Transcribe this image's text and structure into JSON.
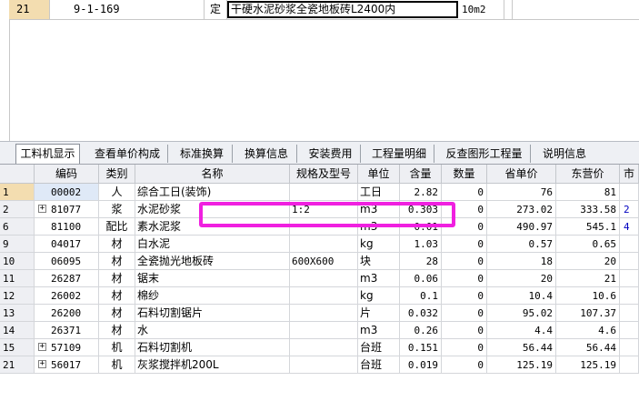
{
  "top_row": {
    "row_num": "21",
    "code": "9-1-169",
    "type": "定",
    "name": "干硬水泥砂浆全瓷地板砖L2400内",
    "unit": "10m2"
  },
  "tabs": [
    {
      "label": "工料机显示",
      "active": true
    },
    {
      "label": "查看单价构成"
    },
    {
      "label": "标准换算"
    },
    {
      "label": "换算信息"
    },
    {
      "label": "安装费用"
    },
    {
      "label": "工程量明细"
    },
    {
      "label": "反查图形工程量"
    },
    {
      "label": "说明信息"
    }
  ],
  "columns": [
    "编码",
    "类别",
    "名称",
    "规格及型号",
    "单位",
    "含量",
    "数量",
    "省单价",
    "东营价",
    "市"
  ],
  "rows": [
    {
      "rn": "1",
      "code": "00002",
      "cat": "人",
      "name": "综合工日(装饰)",
      "spec": "",
      "unit": "工日",
      "qty": "2.82",
      "cnt": "0",
      "prov": "76",
      "dong": "81",
      "mkt": ""
    },
    {
      "rn": "2",
      "code": "81077",
      "cat": "浆",
      "name": "水泥砂浆",
      "spec": "1:2",
      "unit": "m3",
      "qty": "0.303",
      "cnt": "0",
      "prov": "273.02",
      "dong": "333.58",
      "mkt": "2",
      "expandable": true
    },
    {
      "rn": "6",
      "code": "81100",
      "cat": "配比",
      "name": "素水泥浆",
      "spec": "",
      "unit": "m3",
      "qty": "0.01",
      "cnt": "0",
      "prov": "490.97",
      "dong": "545.1",
      "mkt": "4"
    },
    {
      "rn": "9",
      "code": "04017",
      "cat": "材",
      "name": "白水泥",
      "spec": "",
      "unit": "kg",
      "qty": "1.03",
      "cnt": "0",
      "prov": "0.57",
      "dong": "0.65",
      "mkt": ""
    },
    {
      "rn": "10",
      "code": "06095",
      "cat": "材",
      "name": "全瓷抛光地板砖",
      "spec": "600X600",
      "unit": "块",
      "qty": "28",
      "cnt": "0",
      "prov": "18",
      "dong": "20",
      "mkt": ""
    },
    {
      "rn": "11",
      "code": "26287",
      "cat": "材",
      "name": "锯末",
      "spec": "",
      "unit": "m3",
      "qty": "0.06",
      "cnt": "0",
      "prov": "20",
      "dong": "21",
      "mkt": ""
    },
    {
      "rn": "12",
      "code": "26002",
      "cat": "材",
      "name": "棉纱",
      "spec": "",
      "unit": "kg",
      "qty": "0.1",
      "cnt": "0",
      "prov": "10.4",
      "dong": "10.6",
      "mkt": ""
    },
    {
      "rn": "13",
      "code": "26200",
      "cat": "材",
      "name": "石料切割锯片",
      "spec": "",
      "unit": "片",
      "qty": "0.032",
      "cnt": "0",
      "prov": "95.02",
      "dong": "107.37",
      "mkt": ""
    },
    {
      "rn": "14",
      "code": "26371",
      "cat": "材",
      "name": "水",
      "spec": "",
      "unit": "m3",
      "qty": "0.26",
      "cnt": "0",
      "prov": "4.4",
      "dong": "4.6",
      "mkt": ""
    },
    {
      "rn": "15",
      "code": "57109",
      "cat": "机",
      "name": "石料切割机",
      "spec": "",
      "unit": "台班",
      "qty": "0.151",
      "cnt": "0",
      "prov": "56.44",
      "dong": "56.44",
      "mkt": "",
      "expandable": true
    },
    {
      "rn": "21",
      "code": "56017",
      "cat": "机",
      "name": "灰浆搅拌机200L",
      "spec": "",
      "unit": "台班",
      "qty": "0.019",
      "cnt": "0",
      "prov": "125.19",
      "dong": "125.19",
      "mkt": "",
      "expandable": true
    }
  ],
  "colors": {
    "highlight": "#f020e0",
    "selected_row": "#f3ddb0",
    "header_bg": "#eeeff3"
  }
}
